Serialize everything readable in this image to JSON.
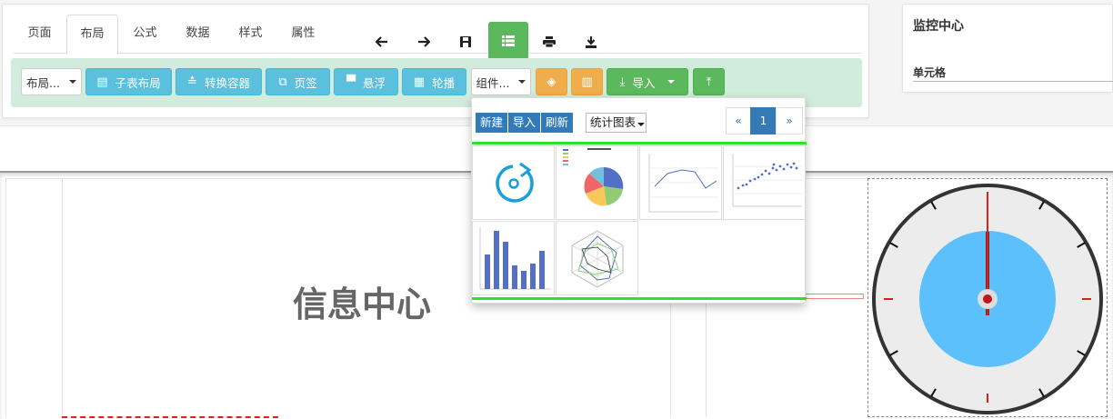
{
  "tabs": [
    {
      "label": "页面"
    },
    {
      "label": "布局"
    },
    {
      "label": "公式"
    },
    {
      "label": "数据"
    },
    {
      "label": "样式"
    },
    {
      "label": "属性"
    }
  ],
  "active_tab": "布局",
  "toolbar_icons": [
    "arrow-left-icon",
    "arrow-right-icon",
    "save-icon",
    "list-icon",
    "print-icon",
    "download-icon"
  ],
  "toolbar": {
    "layout_dropdown": "布局...",
    "subtable_layout": "子表布局",
    "convert_container": "转换容器",
    "page_tab": "页签",
    "float": "悬浮",
    "carousel": "轮播",
    "component_dropdown": "组件...",
    "import": "导入"
  },
  "monitor": {
    "title": "监控中心",
    "cell_label": "单元格"
  },
  "canvas": {
    "title": "信息中心"
  },
  "popup": {
    "new": "新建",
    "import": "导入",
    "refresh": "刷新",
    "chart_type": "统计图表",
    "pager_prev": "«",
    "pager_current": "1",
    "pager_next": "»"
  },
  "colors": {
    "success": "#5cb85c",
    "info": "#5bc0de",
    "warning": "#f0ad4e",
    "primary": "#337ab7",
    "toolbar_bg": "#d1ecdc",
    "clock_face": "#5bc0fb"
  }
}
